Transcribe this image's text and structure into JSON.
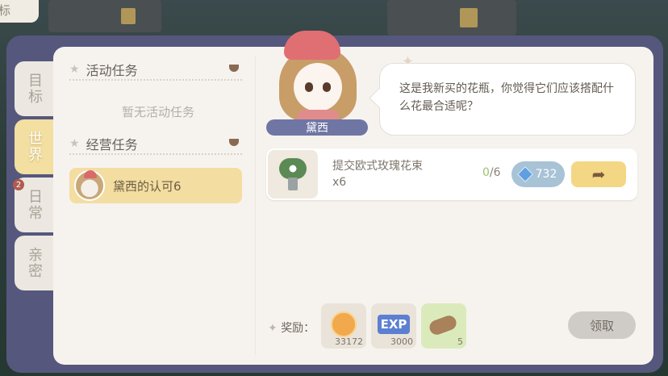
{
  "corner": {
    "label": "标"
  },
  "side_tabs": [
    {
      "label": "目标",
      "active": false
    },
    {
      "label": "世界",
      "active": true
    },
    {
      "label": "日常",
      "active": false,
      "badge": "2"
    },
    {
      "label": "亲密",
      "active": false
    }
  ],
  "sections": {
    "activity": {
      "title": "活动任务",
      "empty_text": "暂无活动任务"
    },
    "business": {
      "title": "经营任务",
      "items": [
        {
          "label": "黛西的认可6"
        }
      ]
    }
  },
  "npc": {
    "name": "黛西",
    "dialogue": "这是我新买的花瓶，你觉得它们应该搭配什么花最合适呢？"
  },
  "requirement": {
    "item_line1": "提交欧式玫瑰花束",
    "item_line2": "x6",
    "current": "0",
    "target": "/6",
    "price": "732"
  },
  "rewards": {
    "label": "奖励：",
    "items": [
      {
        "icon": "gold-coin-icon",
        "count": "33172"
      },
      {
        "icon": "exp-icon",
        "label": "EXP",
        "count": "3000"
      },
      {
        "icon": "wood-icon",
        "count": "5"
      }
    ],
    "claim_label": "领取"
  },
  "colors": {
    "frame": "#56577d",
    "active_tab": "#f2dfa1",
    "price_button": "#a8c2d6",
    "go_button": "#f4d784"
  }
}
